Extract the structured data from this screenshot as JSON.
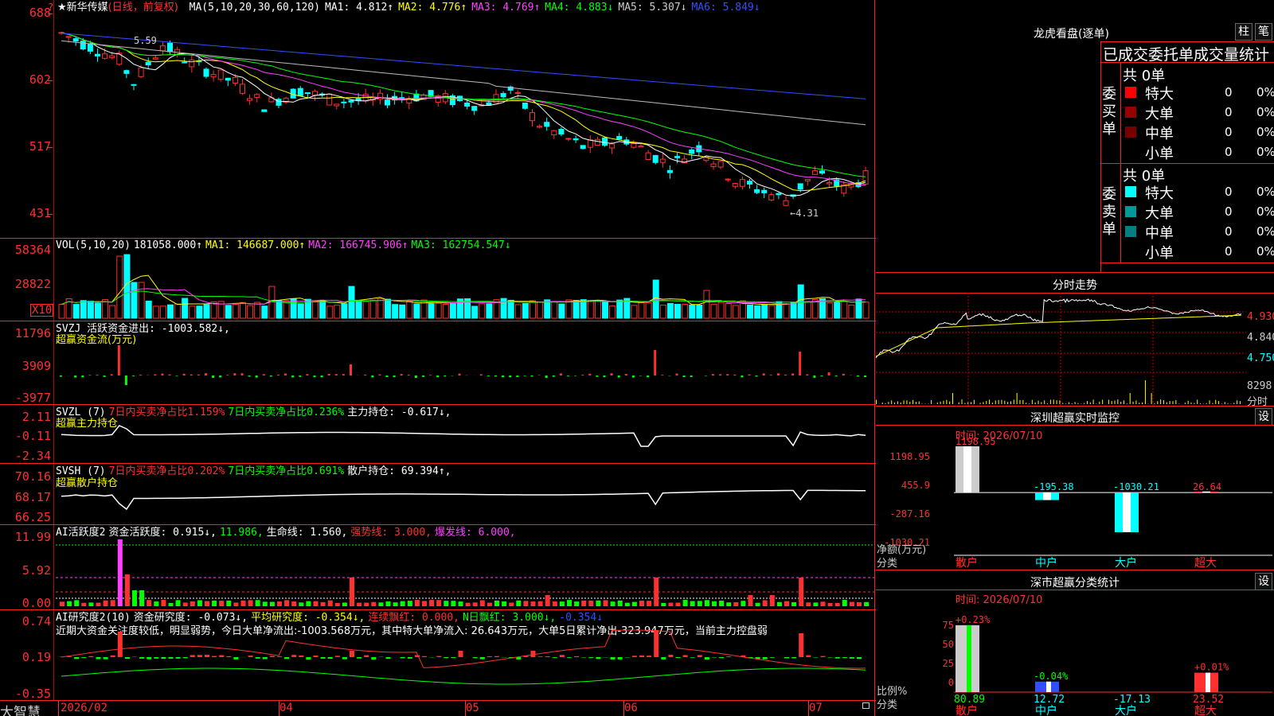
{
  "stock": {
    "title": "★新华传媒",
    "period": "(日线，前复权)",
    "ma_items": [
      {
        "t": "MA(5,10,20,30,60,120)",
        "c": "#ffffff"
      },
      {
        "t": "MA1: 4.812↑",
        "c": "#ffffff"
      },
      {
        "t": "MA2: 4.776↑",
        "c": "#ffff00"
      },
      {
        "t": "MA3: 4.769↑",
        "c": "#ff40ff"
      },
      {
        "t": "MA4: 4.883↓",
        "c": "#00ff00"
      },
      {
        "t": "MA5: 5.307↓",
        "c": "#cccccc"
      },
      {
        "t": "MA6: 5.849↓",
        "c": "#3050ff"
      }
    ]
  },
  "main_axis": {
    "labels": [
      "688",
      "602",
      "517",
      "431"
    ],
    "high_label": "5.59",
    "low_label": "←4.31"
  },
  "vol_panel": {
    "axis": [
      "58364",
      "28822"
    ],
    "unit": "X10",
    "items": [
      {
        "t": "VOL(5,10,20)",
        "c": "#ffffff"
      },
      {
        "t": "181058.000↑",
        "c": "#ffffff"
      },
      {
        "t": "MA1: 146687.000↑",
        "c": "#ffff00"
      },
      {
        "t": "MA2: 166745.906↑",
        "c": "#ff40ff"
      },
      {
        "t": "MA3: 162754.547↓",
        "c": "#00ff00"
      }
    ]
  },
  "svzj_panel": {
    "axis": [
      "11796",
      "3909",
      "-3977"
    ],
    "items": [
      {
        "t": "SVZJ  活跃资金进出: -1003.582↓,",
        "c": "#ffffff"
      }
    ],
    "subtitle": "超赢资金流(万元)"
  },
  "svzl_panel": {
    "axis": [
      "2.11",
      "-0.11",
      "-2.34"
    ],
    "items": [
      {
        "t": "SVZL (7)",
        "c": "#ffffff"
      },
      {
        "t": "7日内买卖净占比1.159%",
        "c": "#ff3030"
      },
      {
        "t": "7日内买卖净占比0.236%",
        "c": "#00ff00"
      },
      {
        "t": "主力持仓: -0.617↓,",
        "c": "#ffffff"
      }
    ],
    "subtitle": "超赢主力持仓"
  },
  "svsh_panel": {
    "axis": [
      "70.16",
      "68.17",
      "66.25"
    ],
    "items": [
      {
        "t": "SVSH (7)",
        "c": "#ffffff"
      },
      {
        "t": "7日内买卖净占比0.202%",
        "c": "#ff3030"
      },
      {
        "t": "7日内买卖净占比0.691%",
        "c": "#00ff00"
      },
      {
        "t": "散户持仓: 69.394↑,",
        "c": "#ffffff"
      }
    ],
    "subtitle": "超赢散户持仓"
  },
  "ai_active_panel": {
    "axis": [
      "11.99",
      "5.92",
      "0.00"
    ],
    "items": [
      {
        "t": "AI活跃度2",
        "c": "#ffffff"
      },
      {
        "t": "资金活跃度: 0.915↓,",
        "c": "#ffffff"
      },
      {
        "t": "11.986,",
        "c": "#00ff00"
      },
      {
        "t": "生命线: 1.560,",
        "c": "#ffffff"
      },
      {
        "t": "强势线: 3.000,",
        "c": "#ff3030"
      },
      {
        "t": "爆发线: 6.000,",
        "c": "#ff40ff"
      }
    ]
  },
  "ai_research_panel": {
    "axis": [
      "0.74",
      "0.19",
      "-0.35"
    ],
    "items": [
      {
        "t": "AI研究度2(10)",
        "c": "#ffffff"
      },
      {
        "t": "资金研究度: -0.073↓,",
        "c": "#ffffff"
      },
      {
        "t": "平均研究度: -0.354↓,",
        "c": "#ffff00"
      },
      {
        "t": "连续飘红: 0.000,",
        "c": "#ff3030"
      },
      {
        "t": "N日飘红: 3.000↓,",
        "c": "#00ff00"
      },
      {
        "t": "-0.354↓",
        "c": "#3050ff"
      }
    ],
    "comment": "近期大资金关注度较低，明显弱势，今日大单净流出:-1003.568万元，其中特大单净流入: 26.643万元，大单5日累计净出-323.947万元，当前主力控盘弱"
  },
  "date_axis": [
    "2026/02",
    "04",
    "05",
    "06",
    "07"
  ],
  "brand": "大智慧",
  "longhu": {
    "title": "龙虎看盘(逐单)",
    "btn1": "柱",
    "btn2": "笔",
    "header": "已成交委托单成交量统计",
    "buy": {
      "label": "委买单",
      "total": "共 0单",
      "rows": [
        {
          "n": "特大",
          "v": "0",
          "p": "0%",
          "c": "#ff0000"
        },
        {
          "n": "大单",
          "v": "0",
          "p": "0%",
          "c": "#990000"
        },
        {
          "n": "中单",
          "v": "0",
          "p": "0%",
          "c": "#770000"
        },
        {
          "n": "小单",
          "v": "0",
          "p": "0%",
          "c": "#000000"
        }
      ]
    },
    "sell": {
      "label": "委卖单",
      "total": "共 0单",
      "rows": [
        {
          "n": "特大",
          "v": "0",
          "p": "0%",
          "c": "#00ffff"
        },
        {
          "n": "大单",
          "v": "0",
          "p": "0%",
          "c": "#009999"
        },
        {
          "n": "中单",
          "v": "0",
          "p": "0%",
          "c": "#008080"
        },
        {
          "n": "小单",
          "v": "0",
          "p": "0%",
          "c": "#000000"
        }
      ]
    }
  },
  "intraday": {
    "title": "分时走势",
    "axis": [
      "4.930",
      "4.840",
      "4.750"
    ],
    "vol_label": "8298",
    "vol_unit": "分时"
  },
  "sz_monitor": {
    "title": "深圳超赢实时监控",
    "btn": "设",
    "time": "时间: 2026/07/10",
    "axis": [
      "1198.95",
      "455.9",
      "-287.16",
      "-1030.21"
    ],
    "ylabel": "净额(万元)",
    "xlabel": "分类",
    "categories": [
      "散户",
      "中户",
      "大户",
      "超大"
    ],
    "values": [
      1198.95,
      -195.38,
      -1030.21,
      26.64
    ],
    "value_labels": [
      "1198.95",
      "-195.38",
      "-1030.21",
      "26.64"
    ]
  },
  "sz_class": {
    "title": "深市超赢分类统计",
    "btn": "设",
    "time": "时间: 2026/07/10",
    "axis": [
      "75",
      "50",
      "25",
      "0"
    ],
    "ylabel": "比例%",
    "xlabel": "分类",
    "categories": [
      "散户",
      "中户",
      "大户",
      "超大"
    ],
    "top_labels": [
      "+0.23%",
      "-0.04%",
      "",
      "+0.01%"
    ],
    "values": [
      80.89,
      12.72,
      -17.13,
      23.52
    ],
    "value_labels": [
      "80.89",
      "12.72",
      "-17.13",
      "23.52"
    ]
  }
}
